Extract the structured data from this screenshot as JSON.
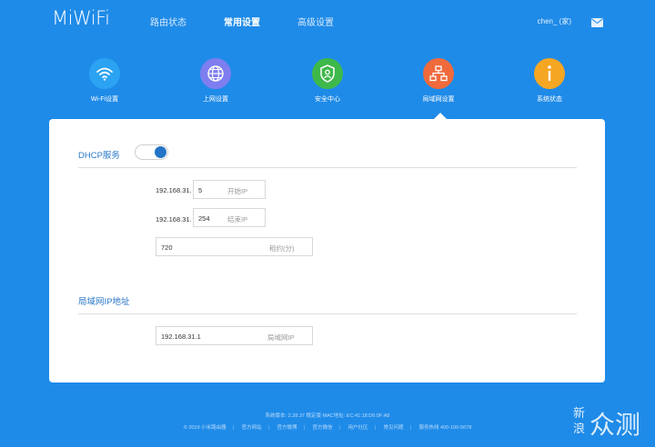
{
  "app": {
    "logo": "MiWiFi"
  },
  "topnav": [
    {
      "label": "路由状态",
      "active": false
    },
    {
      "label": "常用设置",
      "active": true
    },
    {
      "label": "高级设置",
      "active": false
    }
  ],
  "user": {
    "name": "chen_ (家)"
  },
  "nav_icons": [
    {
      "label": "Wi-Fi设置",
      "icon": "wifi-icon",
      "color": "#2ba3f2"
    },
    {
      "label": "上网设置",
      "icon": "globe-icon",
      "color": "#7e7ef0"
    },
    {
      "label": "安全中心",
      "icon": "shield-icon",
      "color": "#3fb84a"
    },
    {
      "label": "局域网设置",
      "icon": "network-icon",
      "color": "#f06a3c"
    },
    {
      "label": "系统状态",
      "icon": "info-icon",
      "color": "#f5a623"
    }
  ],
  "dhcp": {
    "title": "DHCP服务",
    "enabled": true,
    "start": {
      "prefix": "192.168.31.",
      "value": "5",
      "placeholder": "开始IP"
    },
    "end": {
      "prefix": "192.168.31.",
      "value": "254",
      "placeholder": "结束IP"
    },
    "lease": {
      "value": "720",
      "placeholder": "租约(分)"
    }
  },
  "lan": {
    "title": "局域网IP地址",
    "ip": {
      "value": "192.168.31.1",
      "placeholder": "局域网IP"
    }
  },
  "footer": {
    "line1": "系统版本: 2.28.37 稳定版   MAC地址: EC:41:18:D6:0F:A8",
    "links": [
      "© 2019 小米路由器",
      "官方网站",
      "官方微博",
      "官方微信",
      "用户社区",
      "常见问题",
      "服务热线 400-100-5678"
    ]
  },
  "watermark": {
    "line1": "新",
    "line2": "浪",
    "big": "众测"
  },
  "colors": {
    "background": "#1f8be8",
    "accent": "#2374c7"
  }
}
